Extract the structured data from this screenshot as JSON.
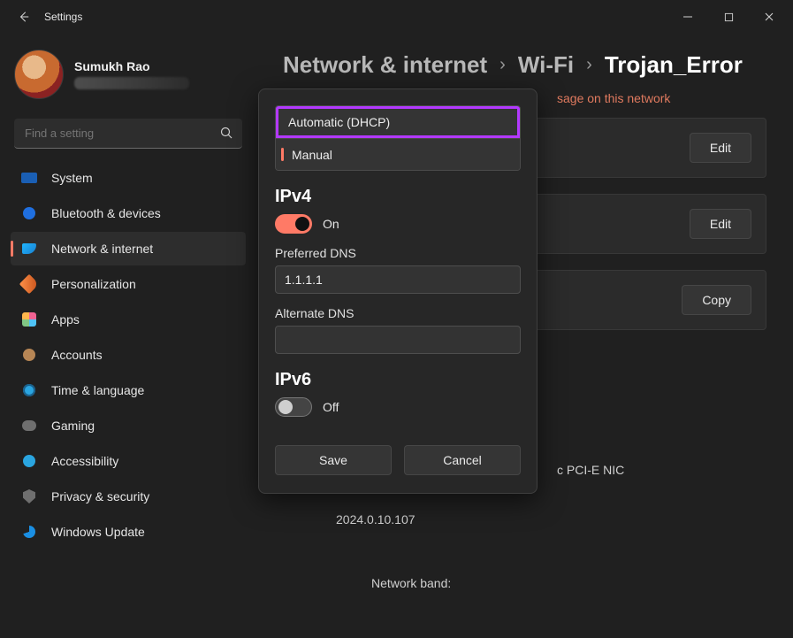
{
  "titlebar": {
    "title": "Settings"
  },
  "profile": {
    "name": "Sumukh Rao"
  },
  "search": {
    "placeholder": "Find a setting"
  },
  "nav": {
    "system": "System",
    "bluetooth": "Bluetooth & devices",
    "network": "Network & internet",
    "personalization": "Personalization",
    "apps": "Apps",
    "accounts": "Accounts",
    "time": "Time & language",
    "gaming": "Gaming",
    "accessibility": "Accessibility",
    "privacy": "Privacy & security",
    "update": "Windows Update"
  },
  "breadcrumb": {
    "root": "Network & internet",
    "mid": "Wi-Fi",
    "leaf": "Trojan_Error",
    "sep": "›"
  },
  "warn_partial": "sage on this network",
  "buttons": {
    "edit": "Edit",
    "copy": "Copy",
    "save": "Save",
    "cancel": "Cancel"
  },
  "nic_partial": "c PCI-E NIC",
  "driver_version": "2024.0.10.107",
  "network_band_label": "Network band:",
  "modal": {
    "dd_auto": "Automatic (DHCP)",
    "dd_manual": "Manual",
    "ipv4_heading": "IPv4",
    "ipv6_heading": "IPv6",
    "on_label": "On",
    "off_label": "Off",
    "pref_dns_label": "Preferred DNS",
    "pref_dns_value": "1.1.1.1",
    "alt_dns_label": "Alternate DNS",
    "alt_dns_value": ""
  }
}
